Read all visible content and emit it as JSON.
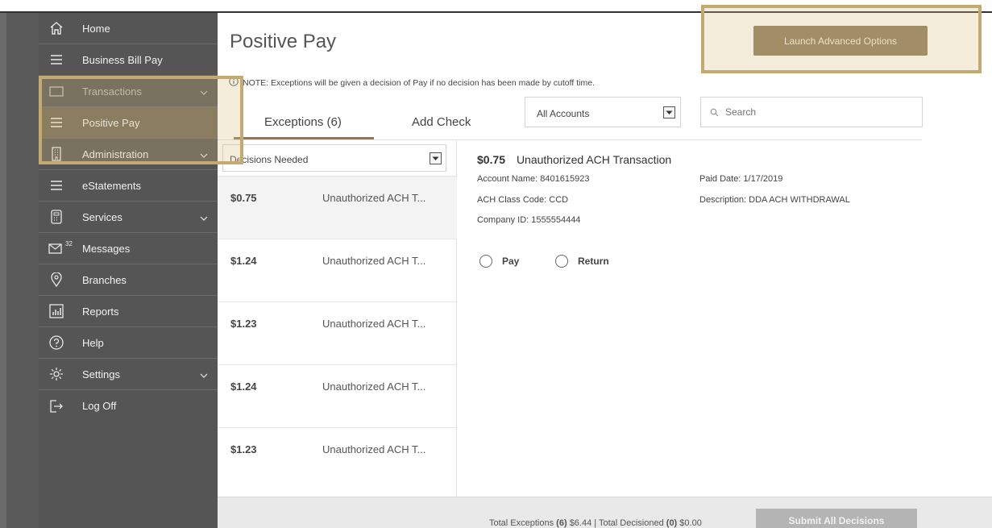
{
  "sidebar": {
    "items": [
      {
        "label": "Home",
        "icon": "home-icon"
      },
      {
        "label": "Business Bill Pay",
        "icon": "menu-icon"
      },
      {
        "label": "Transactions",
        "icon": "card-icon"
      },
      {
        "label": "Positive Pay",
        "icon": "menu-icon"
      },
      {
        "label": "Administration",
        "icon": "building-icon"
      },
      {
        "label": "eStatements",
        "icon": "menu-icon"
      },
      {
        "label": "Services",
        "icon": "calculator-icon"
      },
      {
        "label": "Messages",
        "icon": "mail-icon",
        "badge": "32"
      },
      {
        "label": "Branches",
        "icon": "location-pin-icon"
      },
      {
        "label": "Reports",
        "icon": "bar-chart-icon"
      },
      {
        "label": "Help",
        "icon": "question-icon"
      },
      {
        "label": "Settings",
        "icon": "gear-icon"
      },
      {
        "label": "Log Off",
        "icon": "logout-icon"
      }
    ]
  },
  "header": {
    "title": "Positive Pay",
    "note": "NOTE: Exceptions will be given a decision of Pay if no decision has been made by cutoff time.",
    "launch_button": "Launch Advanced Options"
  },
  "tabs": [
    {
      "label": "Exceptions (6)"
    },
    {
      "label": "Add Check"
    }
  ],
  "filters": {
    "account_select": "All Accounts",
    "search_placeholder": "Search"
  },
  "list": {
    "filter_select": "Decisions Needed",
    "rows": [
      {
        "amount": "$0.75",
        "description": "Unauthorized ACH T..."
      },
      {
        "amount": "$1.24",
        "description": "Unauthorized ACH T..."
      },
      {
        "amount": "$1.23",
        "description": "Unauthorized ACH T..."
      },
      {
        "amount": "$1.24",
        "description": "Unauthorized ACH T..."
      },
      {
        "amount": "$1.23",
        "description": "Unauthorized ACH T..."
      }
    ]
  },
  "detail": {
    "amount": "$0.75",
    "title": "Unauthorized ACH Transaction",
    "account_name": "Account Name: 8401615923",
    "paid_date": "Paid Date: 1/17/2019",
    "ach_class_code": "ACH Class Code: CCD",
    "description": "Description: DDA ACH WITHDRAWAL",
    "company_id": "Company ID: 1555554444",
    "options": {
      "pay": "Pay",
      "return": "Return"
    }
  },
  "footer": {
    "total_exceptions_label": "Total Exceptions",
    "total_exceptions_count": "(6)",
    "total_exceptions_amount": "$6.44",
    "separator": "|",
    "total_decisioned_label": "Total Decisioned",
    "total_decisioned_count": "(0)",
    "total_decisioned_amount": "$0.00",
    "submit_button": "Submit All Decisions"
  },
  "colors": {
    "sidebar": "#555555",
    "accent": "#8c7a5c",
    "highlight": "#c4aa6e",
    "active_item": "#6e6553"
  }
}
